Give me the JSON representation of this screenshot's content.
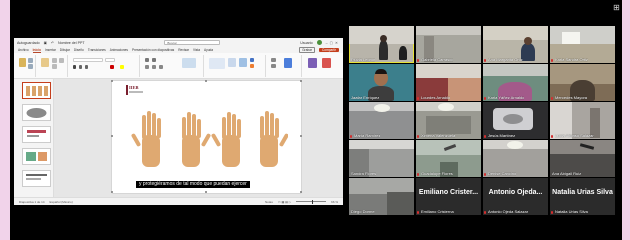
{
  "corner_icon": "grid-icon",
  "ppt": {
    "title_left": "Autoguardado",
    "filename": "Nombre del PPT",
    "search_placeholder": "Buscar",
    "user": "Usuario",
    "tabs": [
      "Archivo",
      "Inicio",
      "Insertar",
      "Dibujar",
      "Diseño",
      "Transiciones",
      "Animaciones",
      "Presentación con diapositivas",
      "Revisar",
      "Vista",
      "Ayuda"
    ],
    "active_tab": 1,
    "record_label": "Grabar",
    "share_label": "Compartir",
    "status_left": "Diapositiva 1 de 14",
    "status_lang": "Español (México)",
    "status_notes": "Notas",
    "status_zoom": "66 %",
    "slide_logo": "IIEB",
    "slide_caption": "y protegiéramos de tal modo que puedan ejercer"
  },
  "tiles": [
    {
      "name": "Pluvia Leonor",
      "mic_off": false,
      "highlighted": true,
      "big": ""
    },
    {
      "name": "Gabriela Carrasco",
      "mic_off": true,
      "highlighted": false,
      "big": ""
    },
    {
      "name": "Ana Margarita Ortiz",
      "mic_off": true,
      "highlighted": false,
      "big": ""
    },
    {
      "name": "Karla Sandra Ortiz",
      "mic_off": true,
      "highlighted": false,
      "big": ""
    },
    {
      "name": "Jaafar Enríquez",
      "mic_off": false,
      "highlighted": false,
      "big": ""
    },
    {
      "name": "Lourdes Arnaldo",
      "mic_off": true,
      "highlighted": false,
      "big": ""
    },
    {
      "name": "Karla Yáñez Arnaldo",
      "mic_off": true,
      "highlighted": false,
      "big": ""
    },
    {
      "name": "Mercedes Mayora",
      "mic_off": true,
      "highlighted": false,
      "big": ""
    },
    {
      "name": "María Ramírez",
      "mic_off": true,
      "highlighted": false,
      "big": ""
    },
    {
      "name": "Ximena Valenzuela",
      "mic_off": true,
      "highlighted": false,
      "big": ""
    },
    {
      "name": "Jesús Martínez",
      "mic_off": true,
      "highlighted": false,
      "big": ""
    },
    {
      "name": "Lucía Alfonso Salazar",
      "mic_off": true,
      "highlighted": false,
      "big": ""
    },
    {
      "name": "Sandra Flores",
      "mic_off": false,
      "highlighted": false,
      "big": ""
    },
    {
      "name": "Guadalupe Flores",
      "mic_off": true,
      "highlighted": false,
      "big": ""
    },
    {
      "name": "Denise Cancino",
      "mic_off": true,
      "highlighted": false,
      "big": ""
    },
    {
      "name": "Ana Abigail Ruiz",
      "mic_off": false,
      "highlighted": false,
      "big": ""
    },
    {
      "name": "Diego Dorme",
      "mic_off": false,
      "highlighted": false,
      "big": ""
    },
    {
      "name": "Emiliano Cristerna",
      "mic_off": true,
      "highlighted": false,
      "big": "Emiliano Crister..."
    },
    {
      "name": "Antonio Ojeda Salazar",
      "mic_off": true,
      "highlighted": false,
      "big": "Antonio Ojeda..."
    },
    {
      "name": "Natalia Urías Silva",
      "mic_off": true,
      "highlighted": false,
      "big": "Natalia Urias Silva"
    }
  ]
}
